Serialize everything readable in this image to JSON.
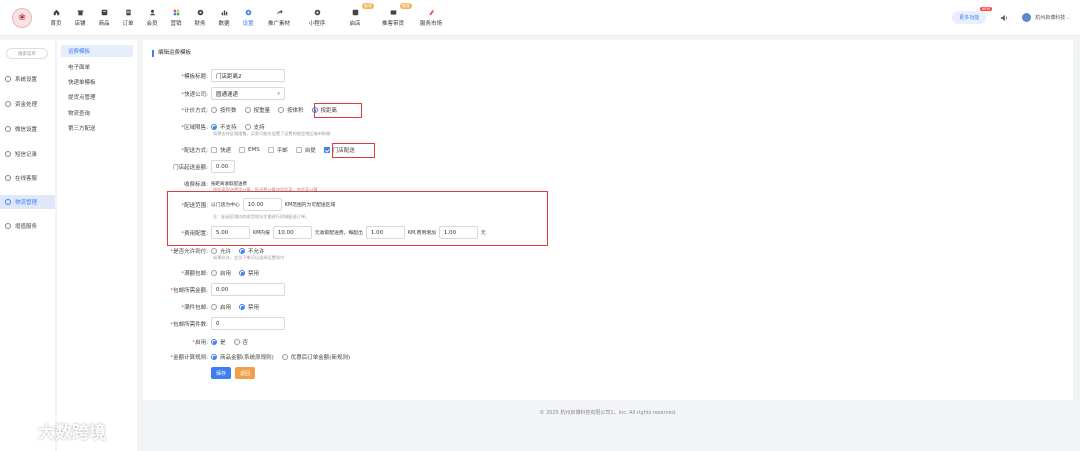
{
  "nav": {
    "items": [
      {
        "label": "首页",
        "icon": "home-icon"
      },
      {
        "label": "店铺",
        "icon": "store-icon"
      },
      {
        "label": "商品",
        "icon": "goods-icon"
      },
      {
        "label": "订单",
        "icon": "order-icon"
      },
      {
        "label": "会员",
        "icon": "member-icon"
      },
      {
        "label": "营销",
        "icon": "marketing-icon"
      },
      {
        "label": "财务",
        "icon": "finance-icon"
      },
      {
        "label": "数据",
        "icon": "chart-icon"
      },
      {
        "label": "设置",
        "icon": "gear-icon"
      },
      {
        "label": "推广素材",
        "icon": "share-icon"
      },
      {
        "label": "小程序",
        "icon": "miniapp-icon"
      },
      {
        "label": "启店",
        "icon": "shop-icon",
        "badge": "推荐"
      },
      {
        "label": "推客带货",
        "icon": "promoter-icon",
        "badge": "推荐"
      },
      {
        "label": "服务市场",
        "icon": "service-icon"
      }
    ],
    "more_button": "更多功能",
    "new_badge": "NEW",
    "user_name": "杭州启博科技..."
  },
  "sidebar": {
    "search_placeholder": "搜索菜单",
    "items": [
      {
        "label": "系统设置",
        "icon": "settings-icon"
      },
      {
        "label": "资金处理",
        "icon": "fund-icon"
      },
      {
        "label": "微信设置",
        "icon": "wechat-icon"
      },
      {
        "label": "短信记录",
        "icon": "sms-icon"
      },
      {
        "label": "在线客服",
        "icon": "service-chat-icon"
      },
      {
        "label": "物流管理",
        "icon": "logistics-icon"
      },
      {
        "label": "增值服务",
        "icon": "value-added-icon"
      }
    ]
  },
  "submenu": {
    "items": [
      "运费模板",
      "电子面单",
      "快递单模板",
      "提货点管理",
      "物流查询",
      "第三方配送"
    ]
  },
  "form": {
    "section_title": "编辑运费模板",
    "template_title_label": "模板标题:",
    "template_title_value": "门店距离2",
    "express_label": "快递公司:",
    "express_value": "圆通速递",
    "pricing_label": "计价方式:",
    "pricing_options": [
      "按件数",
      "按重量",
      "按体积",
      "按距离"
    ],
    "region_label": "区域限售:",
    "region_options": [
      "不支持",
      "支持"
    ],
    "region_hint": "如果支持区域限售，买家只能在设置了运费的指定地区城市购物",
    "delivery_label": "配送方式:",
    "delivery_options": [
      "快递",
      "EMS",
      "平邮",
      "自提",
      "门店配送"
    ],
    "store_min_label": "门店起送金额:",
    "store_min_value": "0.00",
    "fee_std_label": "收费标准:",
    "fee_std_text": "按距离收取配送费",
    "fee_std_hint": "按距离配送费用计算，配送费计算按照距离，按距离计算",
    "range_label": "配送范围:",
    "range_prefix": "以门店为中心",
    "range_value": "10.00",
    "range_suffix": "KM范围内为可配送区域",
    "range_hint": "注：配送区域内的收货地址才能进行同城配送订单。",
    "fee_label": "费用配置:",
    "fee_base_value": "5.00",
    "fee_within_text": "KM内按",
    "fee_km_value": "10.00",
    "fee_mid_text": "元收取配送费，每超出",
    "fee_extra_km": "1.00",
    "fee_extra_text": "KM,费用增加",
    "fee_extra_value": "1.00",
    "fee_unit": "元",
    "arrive_pay_label": "是否允许到付:",
    "arrive_pay_options": [
      "允许",
      "不允许"
    ],
    "arrive_pay_hint": "如果允许，会员下单可以选择运费到付",
    "full_free_label": "满额包邮:",
    "full_free_options": [
      "启用",
      "禁用"
    ],
    "free_amount_label": "包邮所需金额:",
    "free_amount_value": "0.00",
    "piece_free_label": "满件包邮:",
    "piece_free_options": [
      "启用",
      "禁用"
    ],
    "free_pieces_label": "包邮所需件数:",
    "free_pieces_value": "0",
    "enable_label": "启用:",
    "enable_options": [
      "是",
      "否"
    ],
    "calc_rule_label": "金额计算规则:",
    "calc_rule_options": [
      "商品金额(系统原规则)",
      "优惠后订单金额(新规则)"
    ],
    "save_button": "保存",
    "back_button": "返回"
  },
  "footer": "© 2025 杭州启博科技有限公司1，Inc. All rights reserved.",
  "watermark": "大数跨境",
  "colors": {
    "accent": "#3d7ff0",
    "highlight": "#e03c3c",
    "back_button": "#f0a04b"
  }
}
